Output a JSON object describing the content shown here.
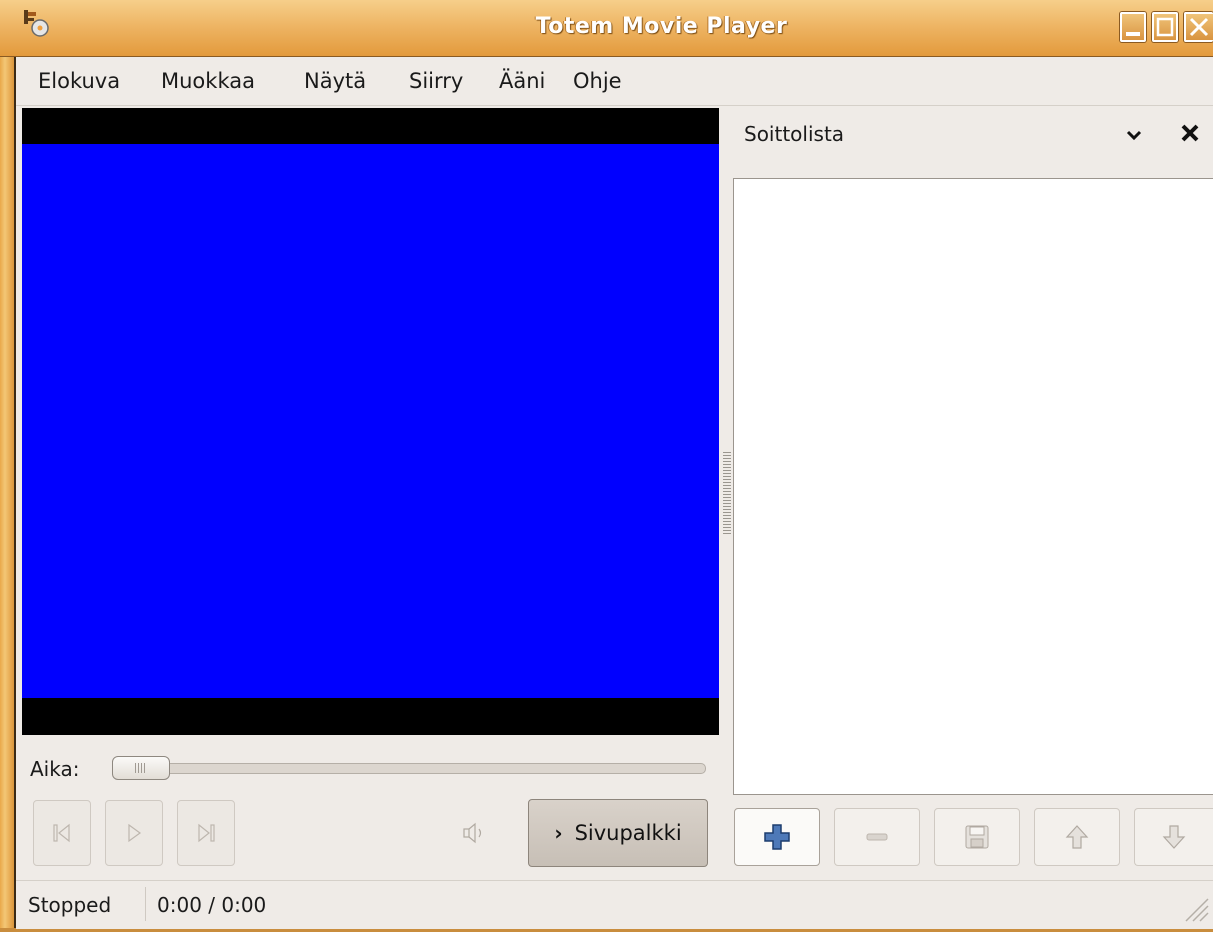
{
  "window": {
    "title": "Totem Movie Player"
  },
  "menubar": {
    "items": [
      {
        "label": "Elokuva"
      },
      {
        "label": "Muokkaa"
      },
      {
        "label": "Näytä"
      },
      {
        "label": "Siirry"
      },
      {
        "label": "Ääni"
      },
      {
        "label": "Ohje"
      }
    ]
  },
  "video": {
    "background_color": "#0000ff",
    "letterbox_color": "#000000"
  },
  "seek": {
    "label": "Aika:",
    "position": 0
  },
  "controls": {
    "previous_icon": "skip-back-icon",
    "play_icon": "play-icon",
    "next_icon": "skip-forward-icon",
    "volume_icon": "speaker-icon",
    "sidebar_toggle_label": "Sivupalkki"
  },
  "playlist": {
    "title": "Soittolista",
    "items": [],
    "buttons": {
      "add_icon": "plus-icon",
      "remove_icon": "minus-icon",
      "save_icon": "floppy-icon",
      "up_icon": "arrow-up-icon",
      "down_icon": "arrow-down-icon"
    }
  },
  "statusbar": {
    "state": "Stopped",
    "time": "0:00 / 0:00"
  }
}
